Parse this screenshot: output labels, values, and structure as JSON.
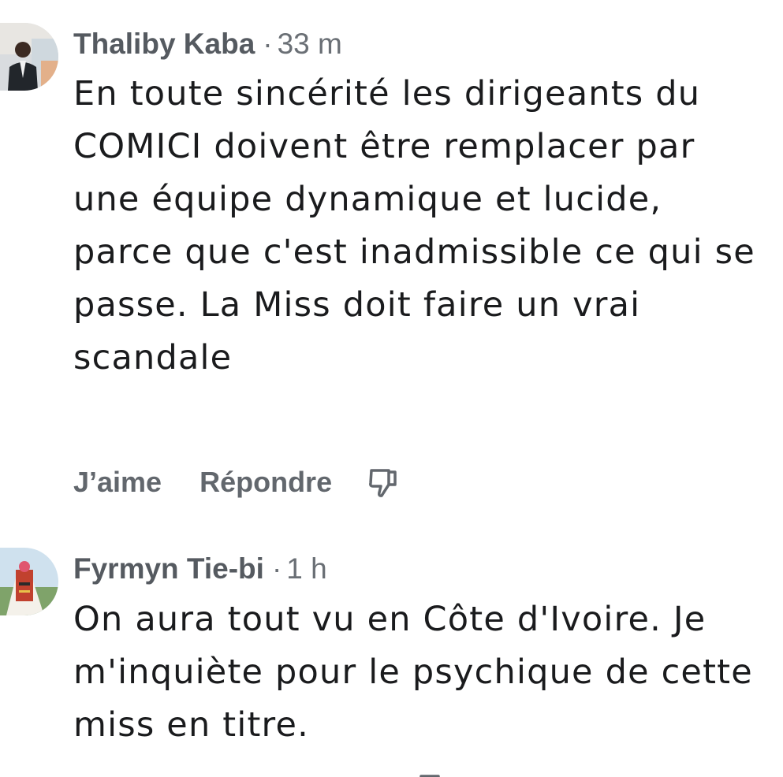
{
  "comments": [
    {
      "author": "Thaliby Kaba",
      "separator": "·",
      "time": "33 m",
      "text": "En toute sincérité les dirigeants du COMICI doivent être remplacer par une équipe dynamique et lucide, parce que c'est inadmissible ce qui se passe. La Miss doit faire un vrai scandale",
      "actions": {
        "like_label": "J’aime",
        "reply_label": "Répondre",
        "dislike_icon": "thumbs-down-icon"
      }
    },
    {
      "author": "Fyrmyn Tie-bi",
      "separator": "·",
      "time": "1 h",
      "text": "On aura tout vu en Côte d'Ivoire. Je m'inquiète pour le psychique de cette miss en titre."
    }
  ],
  "colors": {
    "author": "#555a60",
    "meta": "#6a6f75",
    "body": "#1a1b1d",
    "action": "#62676d"
  }
}
